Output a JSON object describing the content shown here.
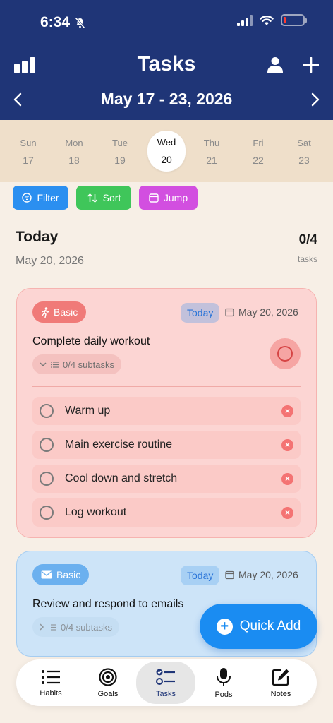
{
  "status_bar": {
    "time": "6:34"
  },
  "header": {
    "title": "Tasks",
    "week_range": "May 17 - 23, 2026"
  },
  "week_days": [
    {
      "name": "Sun",
      "date": "17"
    },
    {
      "name": "Mon",
      "date": "18"
    },
    {
      "name": "Tue",
      "date": "19"
    },
    {
      "name": "Wed",
      "date": "20"
    },
    {
      "name": "Thu",
      "date": "21"
    },
    {
      "name": "Fri",
      "date": "22"
    },
    {
      "name": "Sat",
      "date": "23"
    }
  ],
  "selected_day": "Wed",
  "toolbar": {
    "filter": "Filter",
    "sort": "Sort",
    "jump": "Jump"
  },
  "section": {
    "title": "Today",
    "date": "May 20, 2026",
    "count": "0/4",
    "count_label": "tasks"
  },
  "tasks": [
    {
      "category": "Basic",
      "badge": "Today",
      "date": "May 20, 2026",
      "title": "Complete daily workout",
      "subtasks_summary": "0/4 subtasks",
      "color": "#f07a78",
      "subtasks": [
        {
          "label": "Warm up"
        },
        {
          "label": "Main exercise routine"
        },
        {
          "label": "Cool down and stretch"
        },
        {
          "label": "Log workout"
        }
      ]
    },
    {
      "category": "Basic",
      "badge": "Today",
      "date": "May 20, 2026",
      "title": "Review and respond to emails",
      "subtasks_summary": "0/4 subtasks",
      "color": "#6bb0ef"
    }
  ],
  "quick_add": {
    "label": "Quick Add"
  },
  "tab_bar": [
    {
      "label": "Habits",
      "icon": "list-icon"
    },
    {
      "label": "Goals",
      "icon": "target-icon"
    },
    {
      "label": "Tasks",
      "icon": "checklist-icon"
    },
    {
      "label": "Pods",
      "icon": "microphone-icon"
    },
    {
      "label": "Notes",
      "icon": "note-edit-icon"
    }
  ],
  "active_tab": "Tasks",
  "colors": {
    "header_bg": "#1f3577",
    "filter": "#2b8ff0",
    "sort": "#3fc65a",
    "jump": "#d24fe0",
    "quick_add": "#1a8cf2"
  }
}
